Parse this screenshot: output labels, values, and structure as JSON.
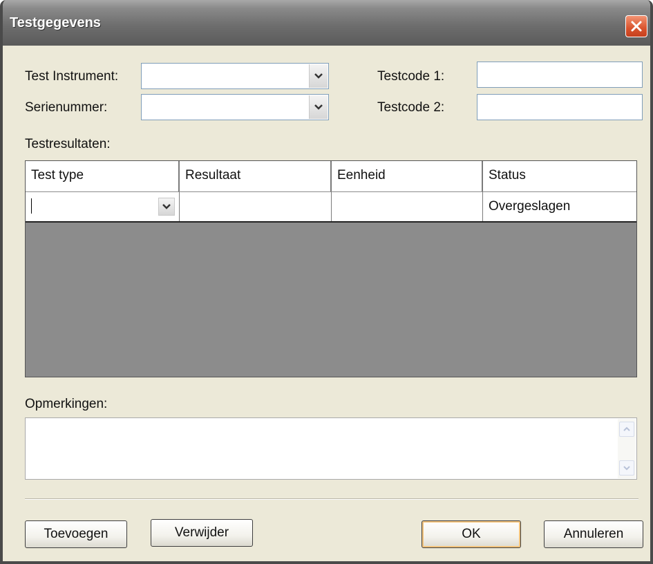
{
  "window": {
    "title": "Testgegevens"
  },
  "form": {
    "instrument_label": "Test Instrument:",
    "instrument_value": "",
    "serial_label": "Serienummer:",
    "serial_value": "",
    "testcode1_label": "Testcode 1:",
    "testcode1_value": "",
    "testcode2_label": "Testcode 2:",
    "testcode2_value": ""
  },
  "results": {
    "label": "Testresultaten:",
    "columns": [
      "Test type",
      "Resultaat",
      "Eenheid",
      "Status"
    ],
    "rows": [
      {
        "test_type": "",
        "resultaat": "",
        "eenheid": "",
        "status": "Overgeslagen"
      }
    ]
  },
  "remarks": {
    "label": "Opmerkingen:",
    "value": ""
  },
  "buttons": {
    "add": "Toevoegen",
    "remove": "Verwijder",
    "ok": "OK",
    "cancel": "Annuleren"
  },
  "icons": {
    "close": "close-icon",
    "dropdown": "chevron-down-icon",
    "scroll_up": "chevron-up-icon",
    "scroll_down": "chevron-down-icon"
  },
  "colors": {
    "titlebar": "#6e6e6e",
    "dialog_bg": "#ece9d8",
    "grid_bg": "#8c8c8c",
    "close_button": "#d9532d",
    "default_button_focus": "#f2c27a"
  }
}
